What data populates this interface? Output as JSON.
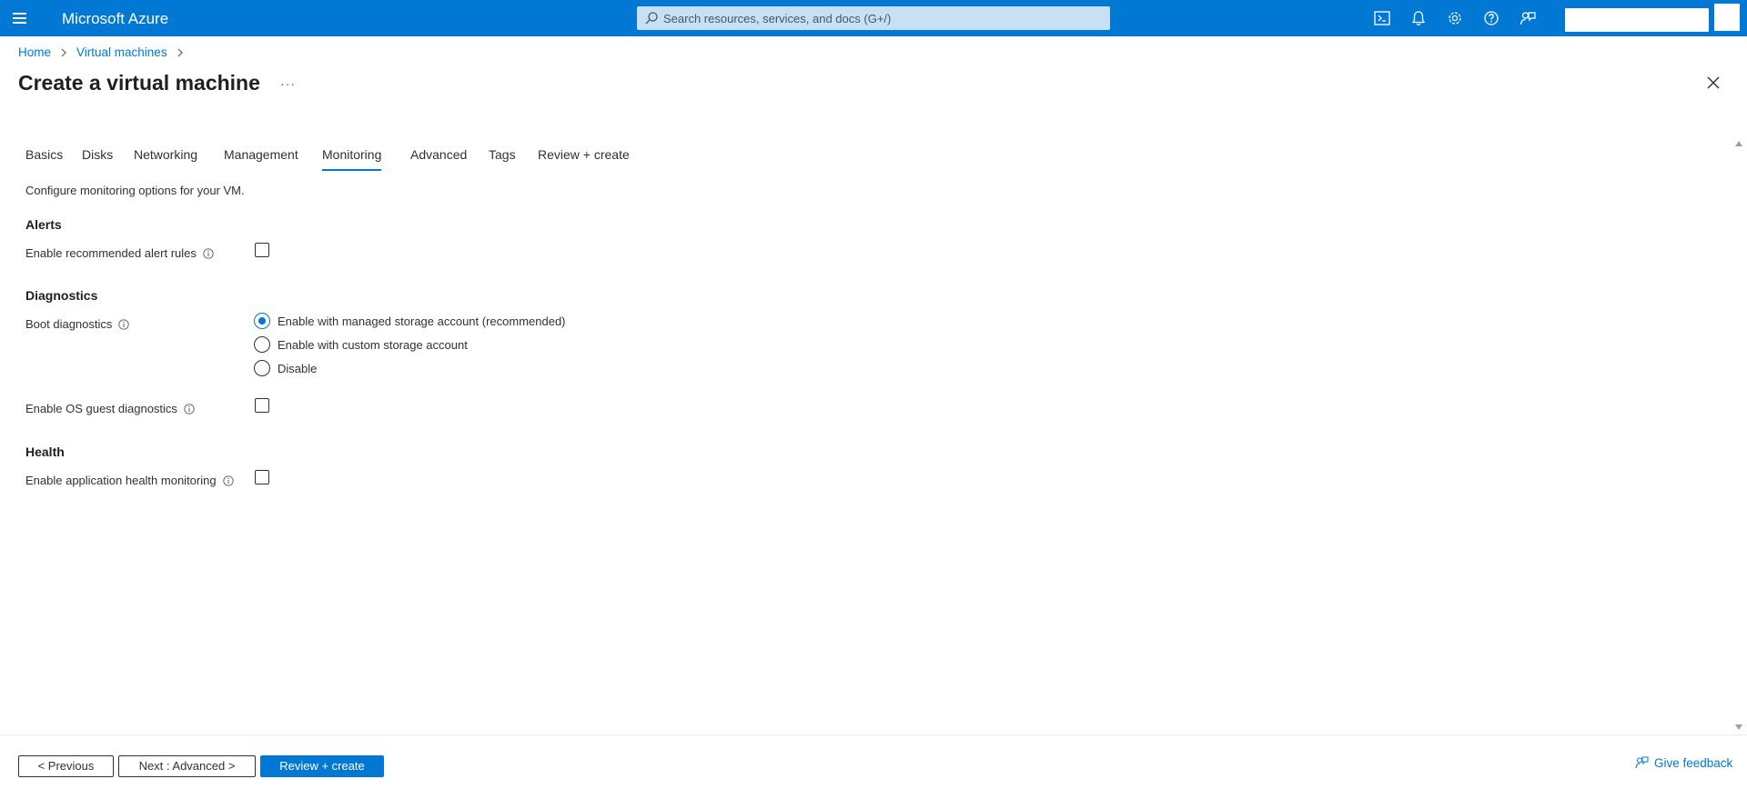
{
  "topbar": {
    "brand": "Microsoft Azure",
    "search_placeholder": "Search resources, services, and docs (G+/)",
    "icons": [
      "cloud-shell-icon",
      "notifications-icon",
      "settings-icon",
      "help-icon",
      "feedback-icon"
    ]
  },
  "breadcrumb": {
    "items": [
      "Home",
      "Virtual machines"
    ]
  },
  "page": {
    "title": "Create a virtual machine",
    "more_label": "···"
  },
  "tabs": [
    {
      "label": "Basics"
    },
    {
      "label": "Disks"
    },
    {
      "label": "Networking"
    },
    {
      "label": "Management"
    },
    {
      "label": "Monitoring",
      "active": true
    },
    {
      "label": "Advanced"
    },
    {
      "label": "Tags"
    },
    {
      "label": "Review + create"
    }
  ],
  "content": {
    "description": "Configure monitoring options for your VM.",
    "alerts": {
      "heading": "Alerts",
      "recommended_rules_label": "Enable recommended alert rules",
      "recommended_rules_checked": false
    },
    "diagnostics": {
      "heading": "Diagnostics",
      "boot_label": "Boot diagnostics",
      "boot_options": [
        "Enable with managed storage account (recommended)",
        "Enable with custom storage account",
        "Disable"
      ],
      "boot_selected": "Enable with managed storage account (recommended)",
      "os_guest_label": "Enable OS guest diagnostics",
      "os_guest_checked": false
    },
    "health": {
      "heading": "Health",
      "app_health_label": "Enable application health monitoring",
      "app_health_checked": false
    }
  },
  "footer": {
    "previous_label": "< Previous",
    "next_label": "Next : Advanced >",
    "review_label": "Review + create",
    "feedback_label": "Give feedback"
  },
  "colors": {
    "accent": "#0078d4",
    "search_bg": "#c7e0f4",
    "text": "#323130"
  }
}
